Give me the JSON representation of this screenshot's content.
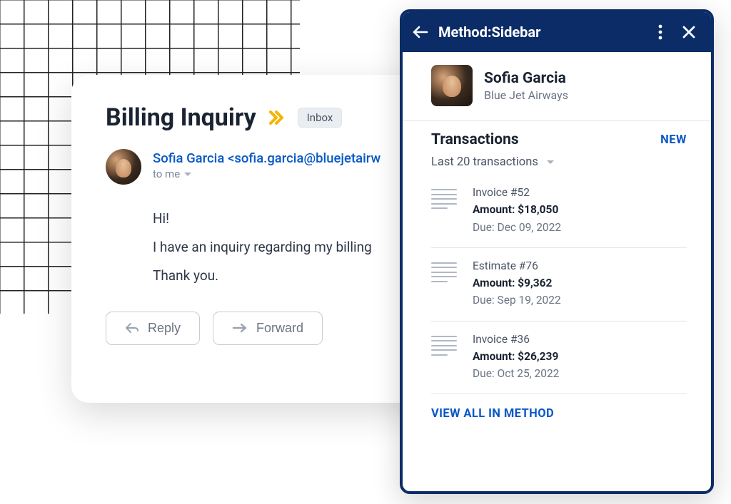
{
  "email": {
    "subject": "Billing Inquiry",
    "tag": "Inbox",
    "sender_display": "Sofia Garcia <sofia.garcia@bluejetairw",
    "recipient_line": "to me",
    "body_line1": "Hi!",
    "body_line2": "I have an inquiry regarding my billing",
    "body_line3": "Thank you.",
    "reply_label": "Reply",
    "forward_label": "Forward"
  },
  "sidebar": {
    "title": "Method:Sidebar",
    "contact": {
      "name": "Sofia Garcia",
      "company": "Blue Jet Airways"
    },
    "transactions": {
      "heading": "Transactions",
      "new_label": "NEW",
      "filter_label": "Last 20 transactions",
      "items": [
        {
          "title": "Invoice #52",
          "amount": "Amount: $18,050",
          "due": "Due: Dec 09, 2022"
        },
        {
          "title": "Estimate #76",
          "amount": "Amount: $9,362",
          "due": "Due: Sep 19, 2022"
        },
        {
          "title": "Invoice #36",
          "amount": "Amount: $26,239",
          "due": "Due: Oct 25, 2022"
        }
      ],
      "view_all_label": "VIEW ALL IN METHOD"
    }
  }
}
